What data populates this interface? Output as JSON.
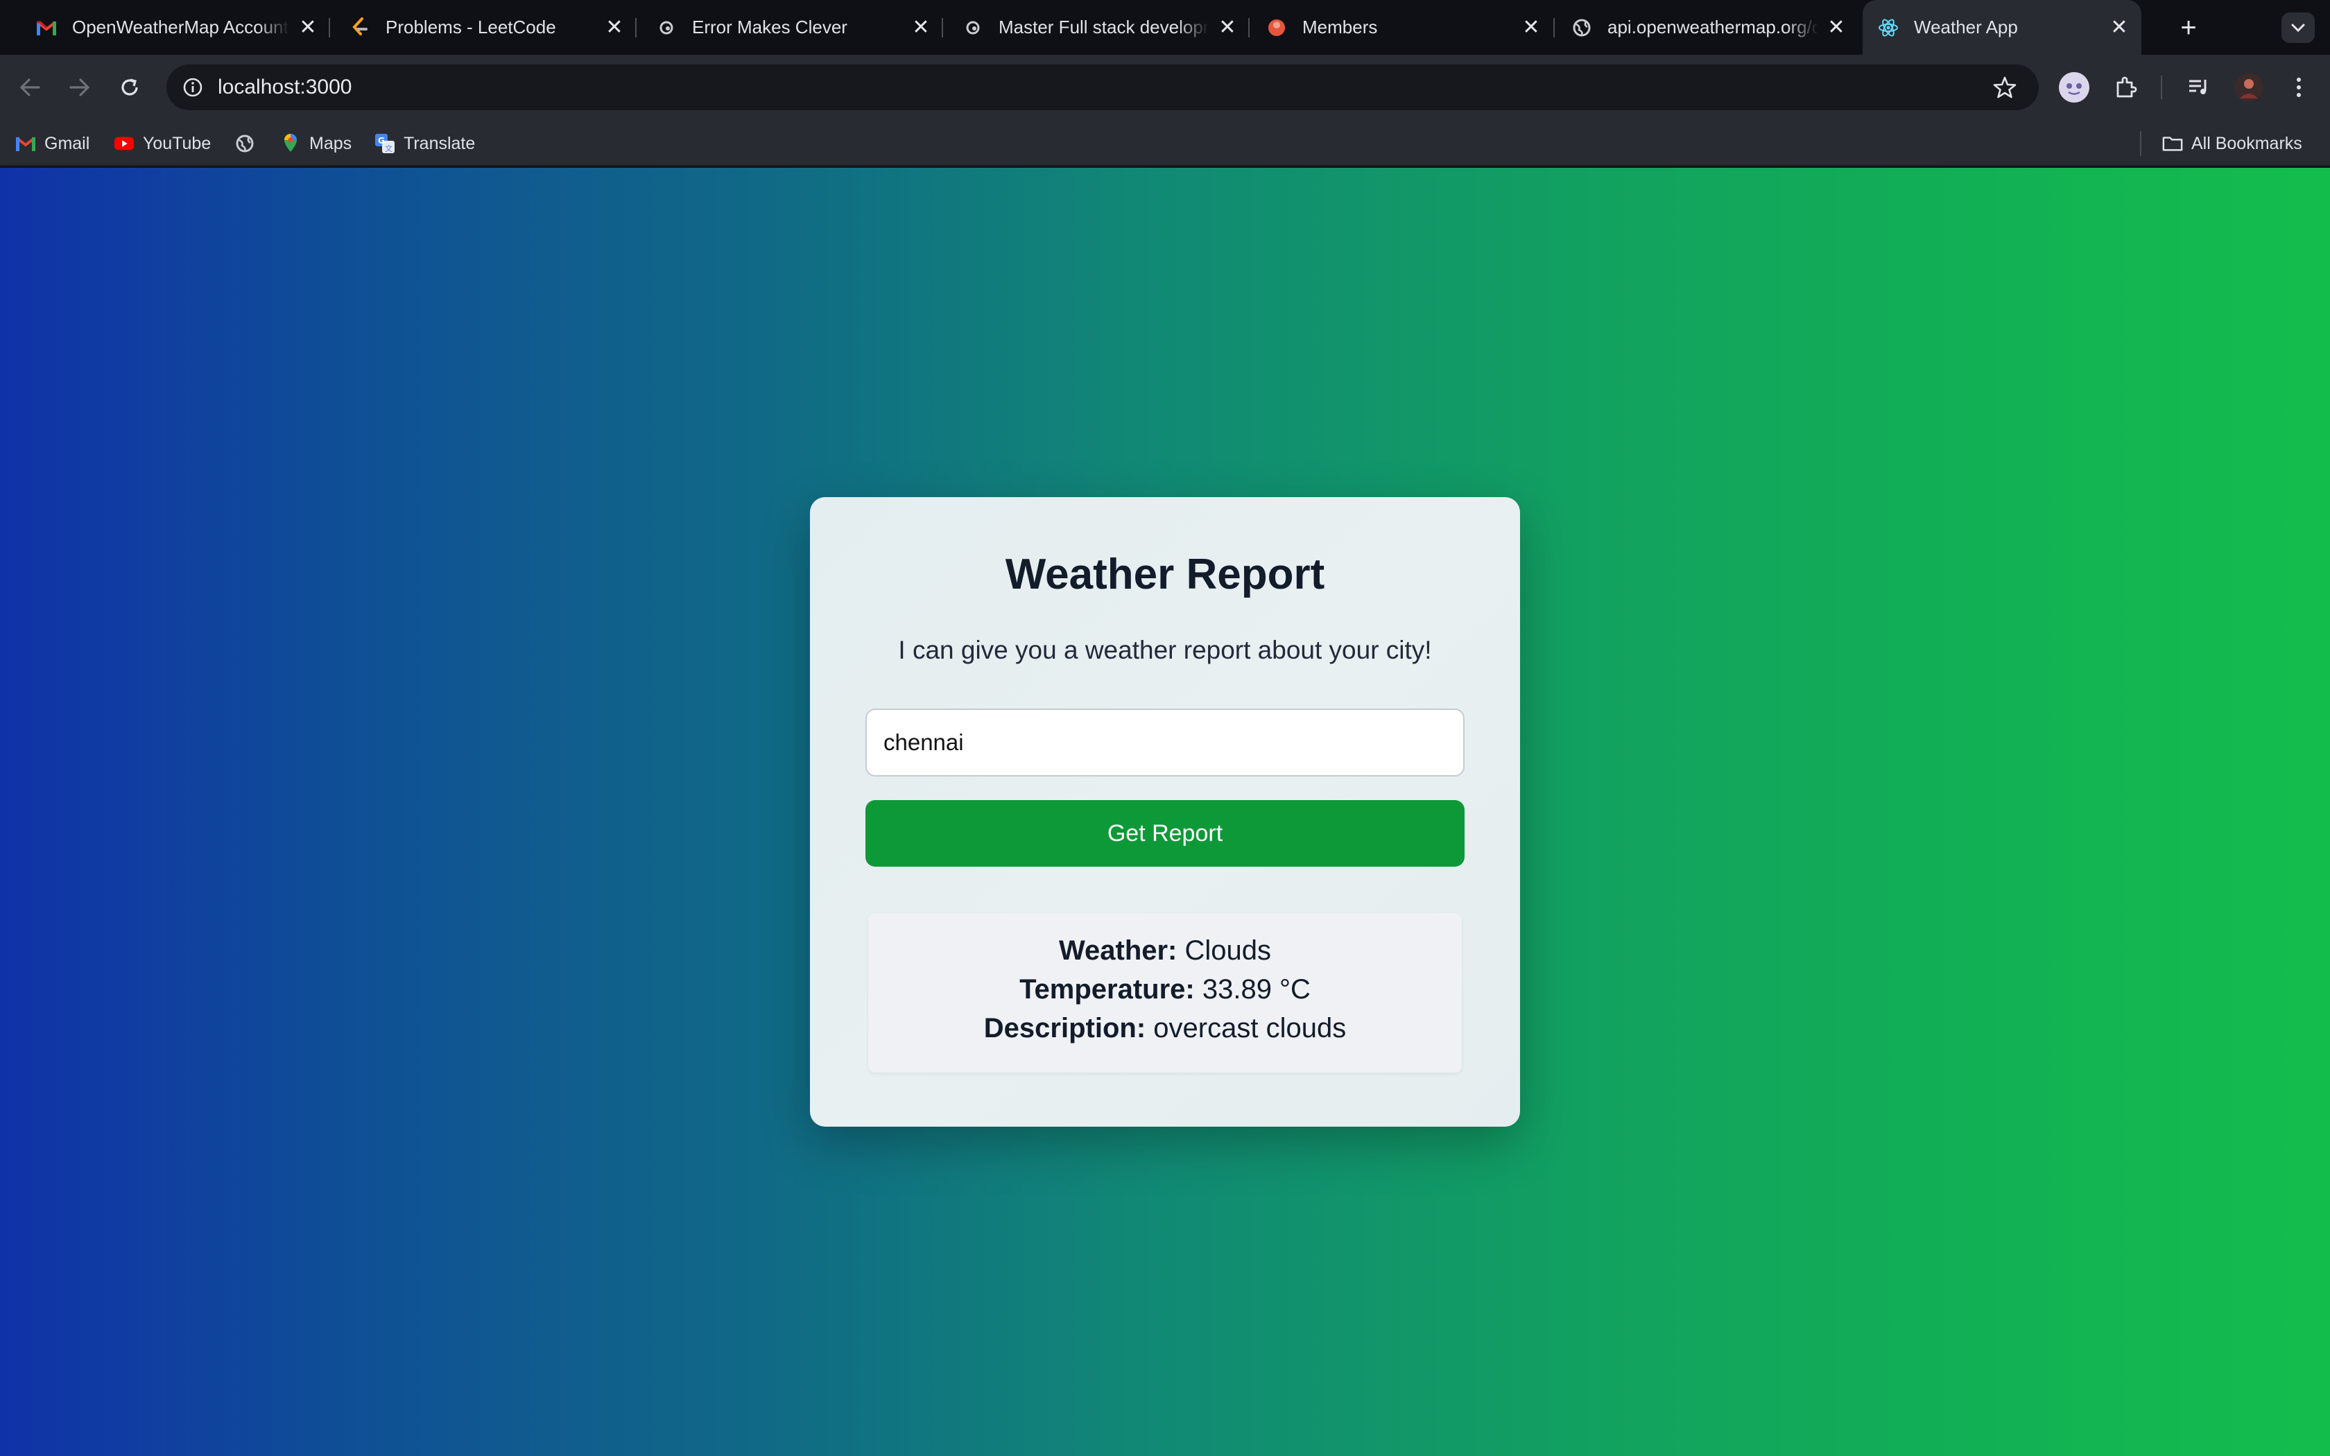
{
  "browser": {
    "tabs": [
      {
        "title": "OpenWeatherMap Account",
        "icon": "gmail-icon"
      },
      {
        "title": "Problems - LeetCode",
        "icon": "leetcode-icon"
      },
      {
        "title": "Error Makes Clever",
        "icon": "emc-icon"
      },
      {
        "title": "Master Full stack development",
        "icon": "emc-icon"
      },
      {
        "title": "Members",
        "icon": "members-icon"
      },
      {
        "title": "api.openweathermap.org/data",
        "icon": "globe-icon"
      },
      {
        "title": "Weather App",
        "icon": "react-icon",
        "active": true
      }
    ],
    "url": "localhost:3000",
    "bookmarks": [
      {
        "label": "Gmail",
        "icon": "gmail-icon"
      },
      {
        "label": "YouTube",
        "icon": "youtube-icon"
      },
      {
        "label": "",
        "icon": "globe-icon"
      },
      {
        "label": "Maps",
        "icon": "maps-icon"
      },
      {
        "label": "Translate",
        "icon": "translate-icon"
      }
    ],
    "all_bookmarks": "All Bookmarks"
  },
  "app": {
    "title": "Weather Report",
    "subtitle": "I can give you a weather report about your city!",
    "city_input": "chennai",
    "button_label": "Get Report",
    "result": {
      "weather_label": "Weather:",
      "weather_value": "Clouds",
      "temperature_label": "Temperature:",
      "temperature_value": "33.89 °C",
      "description_label": "Description:",
      "description_value": "overcast clouds"
    }
  },
  "colors": {
    "gradient_left": "#1032a8",
    "gradient_right": "#13bd4c",
    "button": "#0e9938",
    "card": "#e6eef0"
  }
}
